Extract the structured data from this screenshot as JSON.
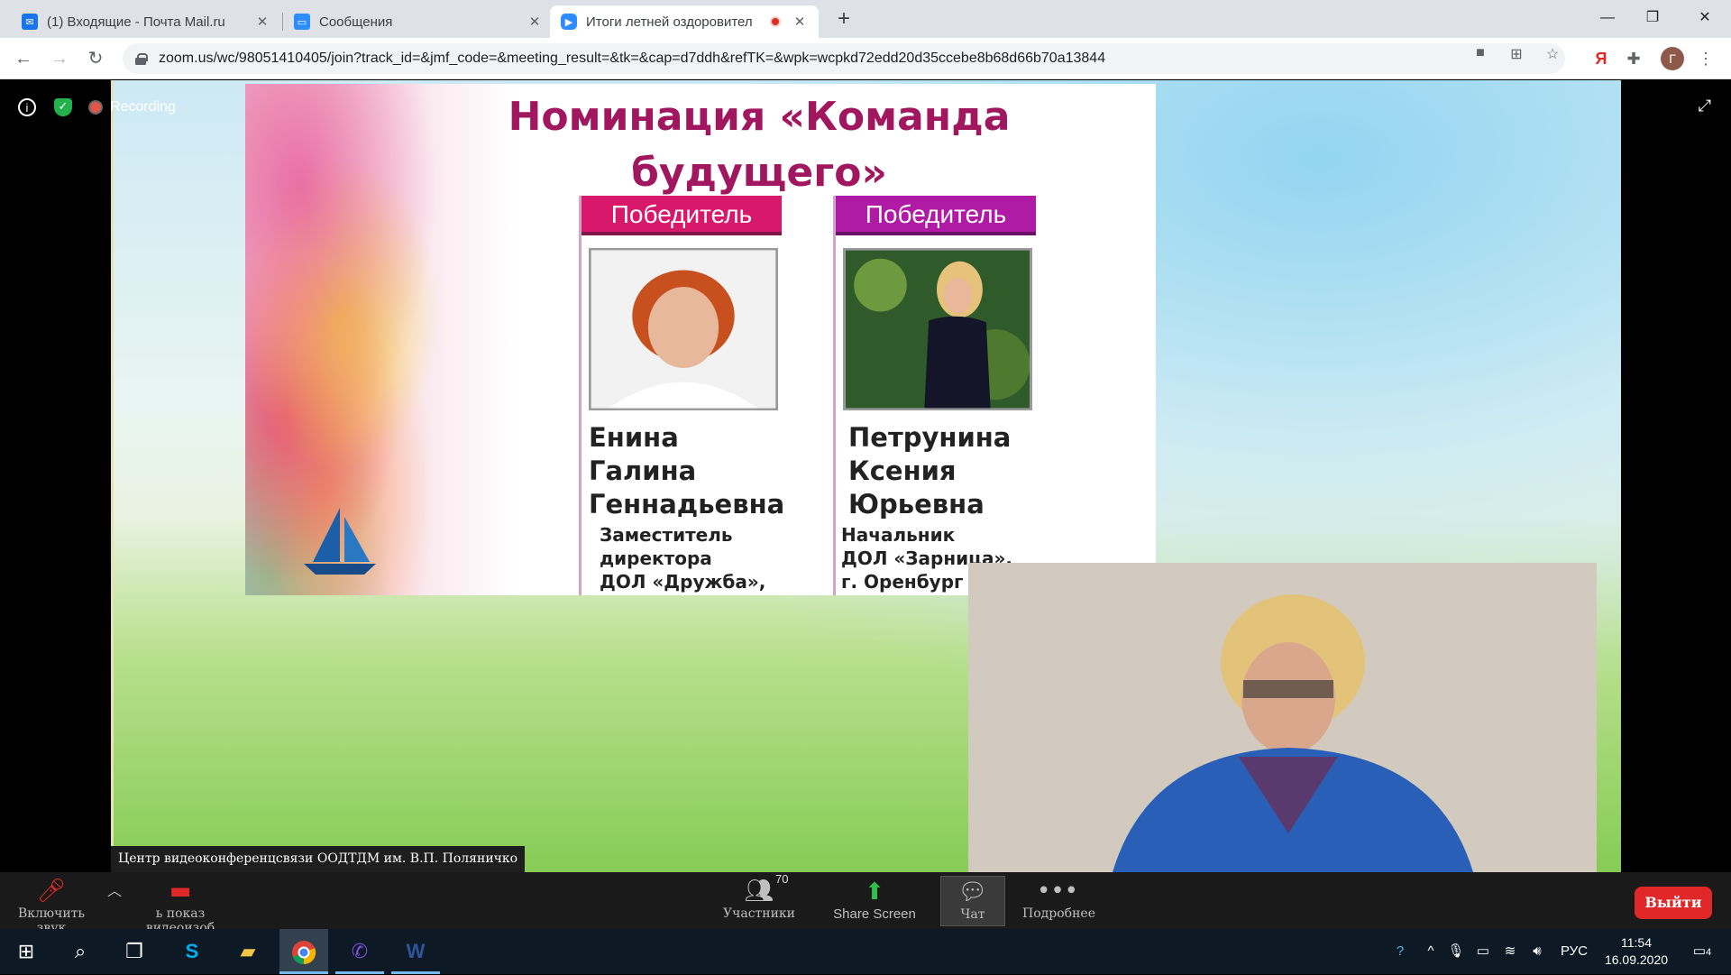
{
  "browser": {
    "tabs": [
      {
        "title": "(1) Входящие - Почта Mail.ru",
        "icon": "mail-icon",
        "color": "#1a73e8"
      },
      {
        "title": "Сообщения",
        "icon": "chat-icon",
        "color": "#2d8cff"
      },
      {
        "title": "Итоги летней оздоровител",
        "icon": "zoom-icon",
        "color": "#2d8cff"
      }
    ],
    "url": "zoom.us/wc/98051410405/join?track_id=&jmf_code=&meeting_result=&tk=&cap=d7ddh&refTK=&wpk=wcpkd72edd20d35ccebe8b68d66b70a13844",
    "profile_initial": "Г",
    "yandex_label": "Я"
  },
  "zoom": {
    "recording_label": "Recording",
    "video_name": "Центр видеоконференцсвязи ООДТДМ им. В.П. Поляничко",
    "slide": {
      "title_line1": "Номинация «Команда",
      "title_line2": "будущего»",
      "winners": [
        {
          "badge": "Победитель",
          "badge_color": "#d8196b",
          "name": [
            "Енина",
            "Галина",
            "Геннадьевна"
          ],
          "role": [
            "Заместитель",
            "директора",
            "ДОЛ «Дружба»,"
          ]
        },
        {
          "badge": "Победитель",
          "badge_color": "#b01aa5",
          "name": [
            "Петрунина",
            "Ксения",
            "Юрьевна"
          ],
          "role": [
            "Начальник",
            "ДОЛ «Зарница»,",
            "г. Оренбург"
          ]
        }
      ]
    },
    "toolbar": {
      "unmute_label": "Включить звук",
      "video_label": "ь показ видеоизоб",
      "participants_label": "Участники",
      "participants_count": "70",
      "share_label": "Share Screen",
      "chat_label": "Чат",
      "more_label": "Подробнее",
      "leave_label": "Выйти"
    }
  },
  "taskbar": {
    "language": "РУС",
    "time": "11:54",
    "date": "16.09.2020",
    "notifications": "4"
  }
}
